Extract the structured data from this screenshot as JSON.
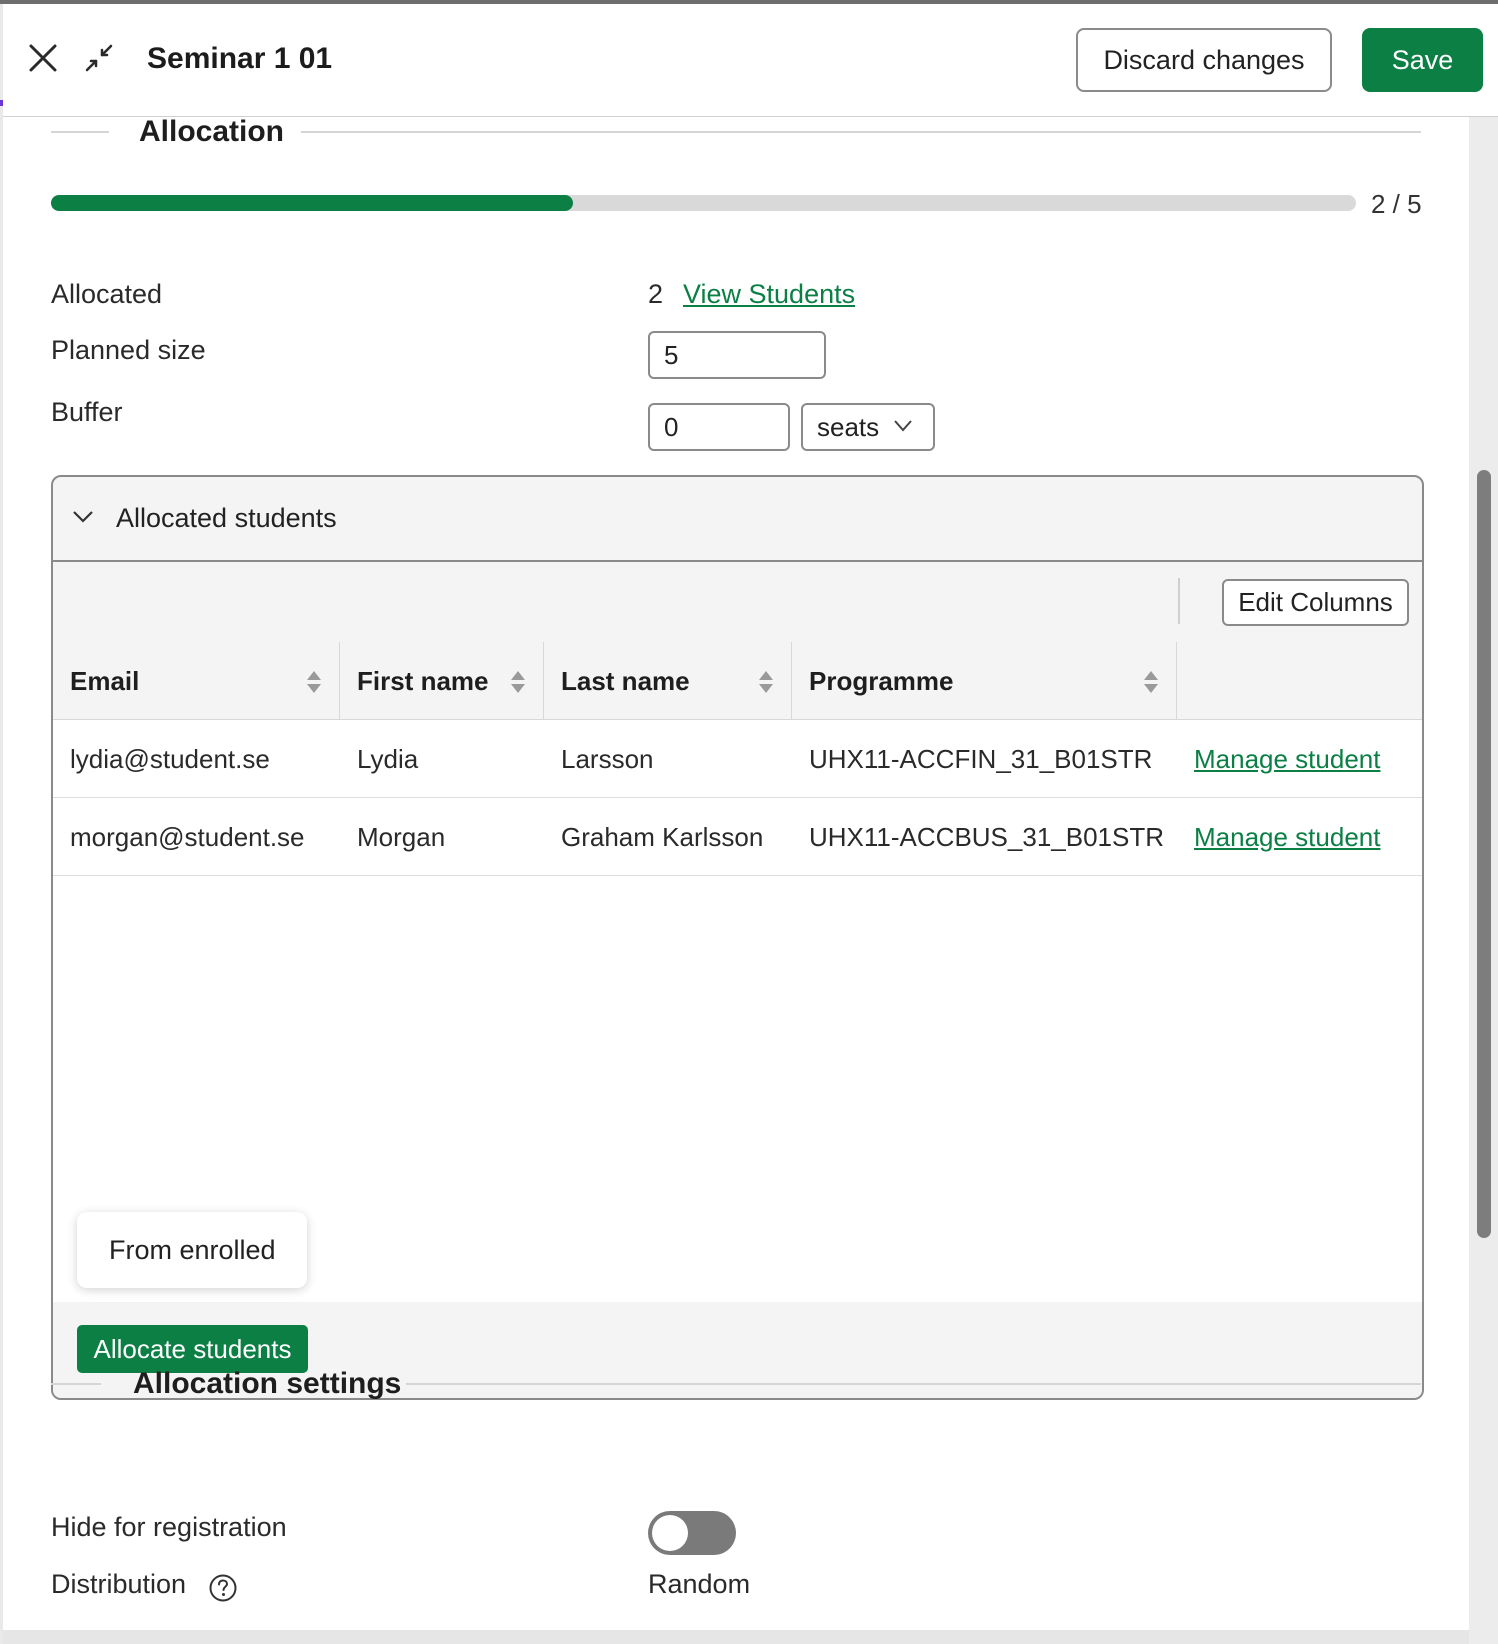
{
  "header": {
    "title": "Seminar 1 01",
    "discard_label": "Discard changes",
    "save_label": "Save"
  },
  "allocation": {
    "section_title": "Allocation",
    "progress_text": "2 / 5",
    "progress_fraction": 0.4,
    "allocated_label": "Allocated",
    "allocated_count": "2",
    "view_students_label": "View Students",
    "planned_size_label": "Planned size",
    "planned_size_value": "5",
    "buffer_label": "Buffer",
    "buffer_value": "0",
    "buffer_unit": "seats"
  },
  "allocated_students": {
    "panel_title": "Allocated students",
    "edit_columns_label": "Edit Columns",
    "columns": [
      "Email",
      "First name",
      "Last name",
      "Programme"
    ],
    "rows": [
      {
        "email": "lydia@student.se",
        "first_name": "Lydia",
        "last_name": "Larsson",
        "programme": "UHX11-ACCFIN_31_B01STR",
        "action": "Manage student"
      },
      {
        "email": "morgan@student.se",
        "first_name": "Morgan",
        "last_name": "Graham Karlsson",
        "programme": "UHX11-ACCBUS_31_B01STR",
        "action": "Manage student"
      }
    ],
    "popup_option": "From enrolled",
    "allocate_button": "Allocate students"
  },
  "allocation_settings": {
    "section_title": "Allocation settings",
    "hide_label": "Hide for registration",
    "hide_enabled": false,
    "distribution_label": "Distribution",
    "distribution_value": "Random"
  },
  "colors": {
    "accent": "#0c7f45",
    "border": "#8a8a8a"
  }
}
